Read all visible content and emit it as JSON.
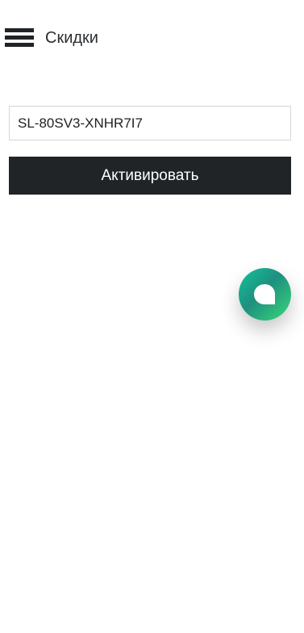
{
  "header": {
    "menu_icon": "hamburger-menu-icon",
    "title": "Скидки"
  },
  "coupon": {
    "value": "SL-80SV3-XNHR7I7",
    "placeholder": ""
  },
  "activate_button": {
    "label": "Активировать"
  },
  "chat_widget": {
    "icon": "chat-bubble-icon"
  },
  "colors": {
    "button_bg": "#212427",
    "button_text": "#ffffff",
    "chat_gradient_start": "#10c49c",
    "chat_gradient_end": "#39d97a"
  }
}
